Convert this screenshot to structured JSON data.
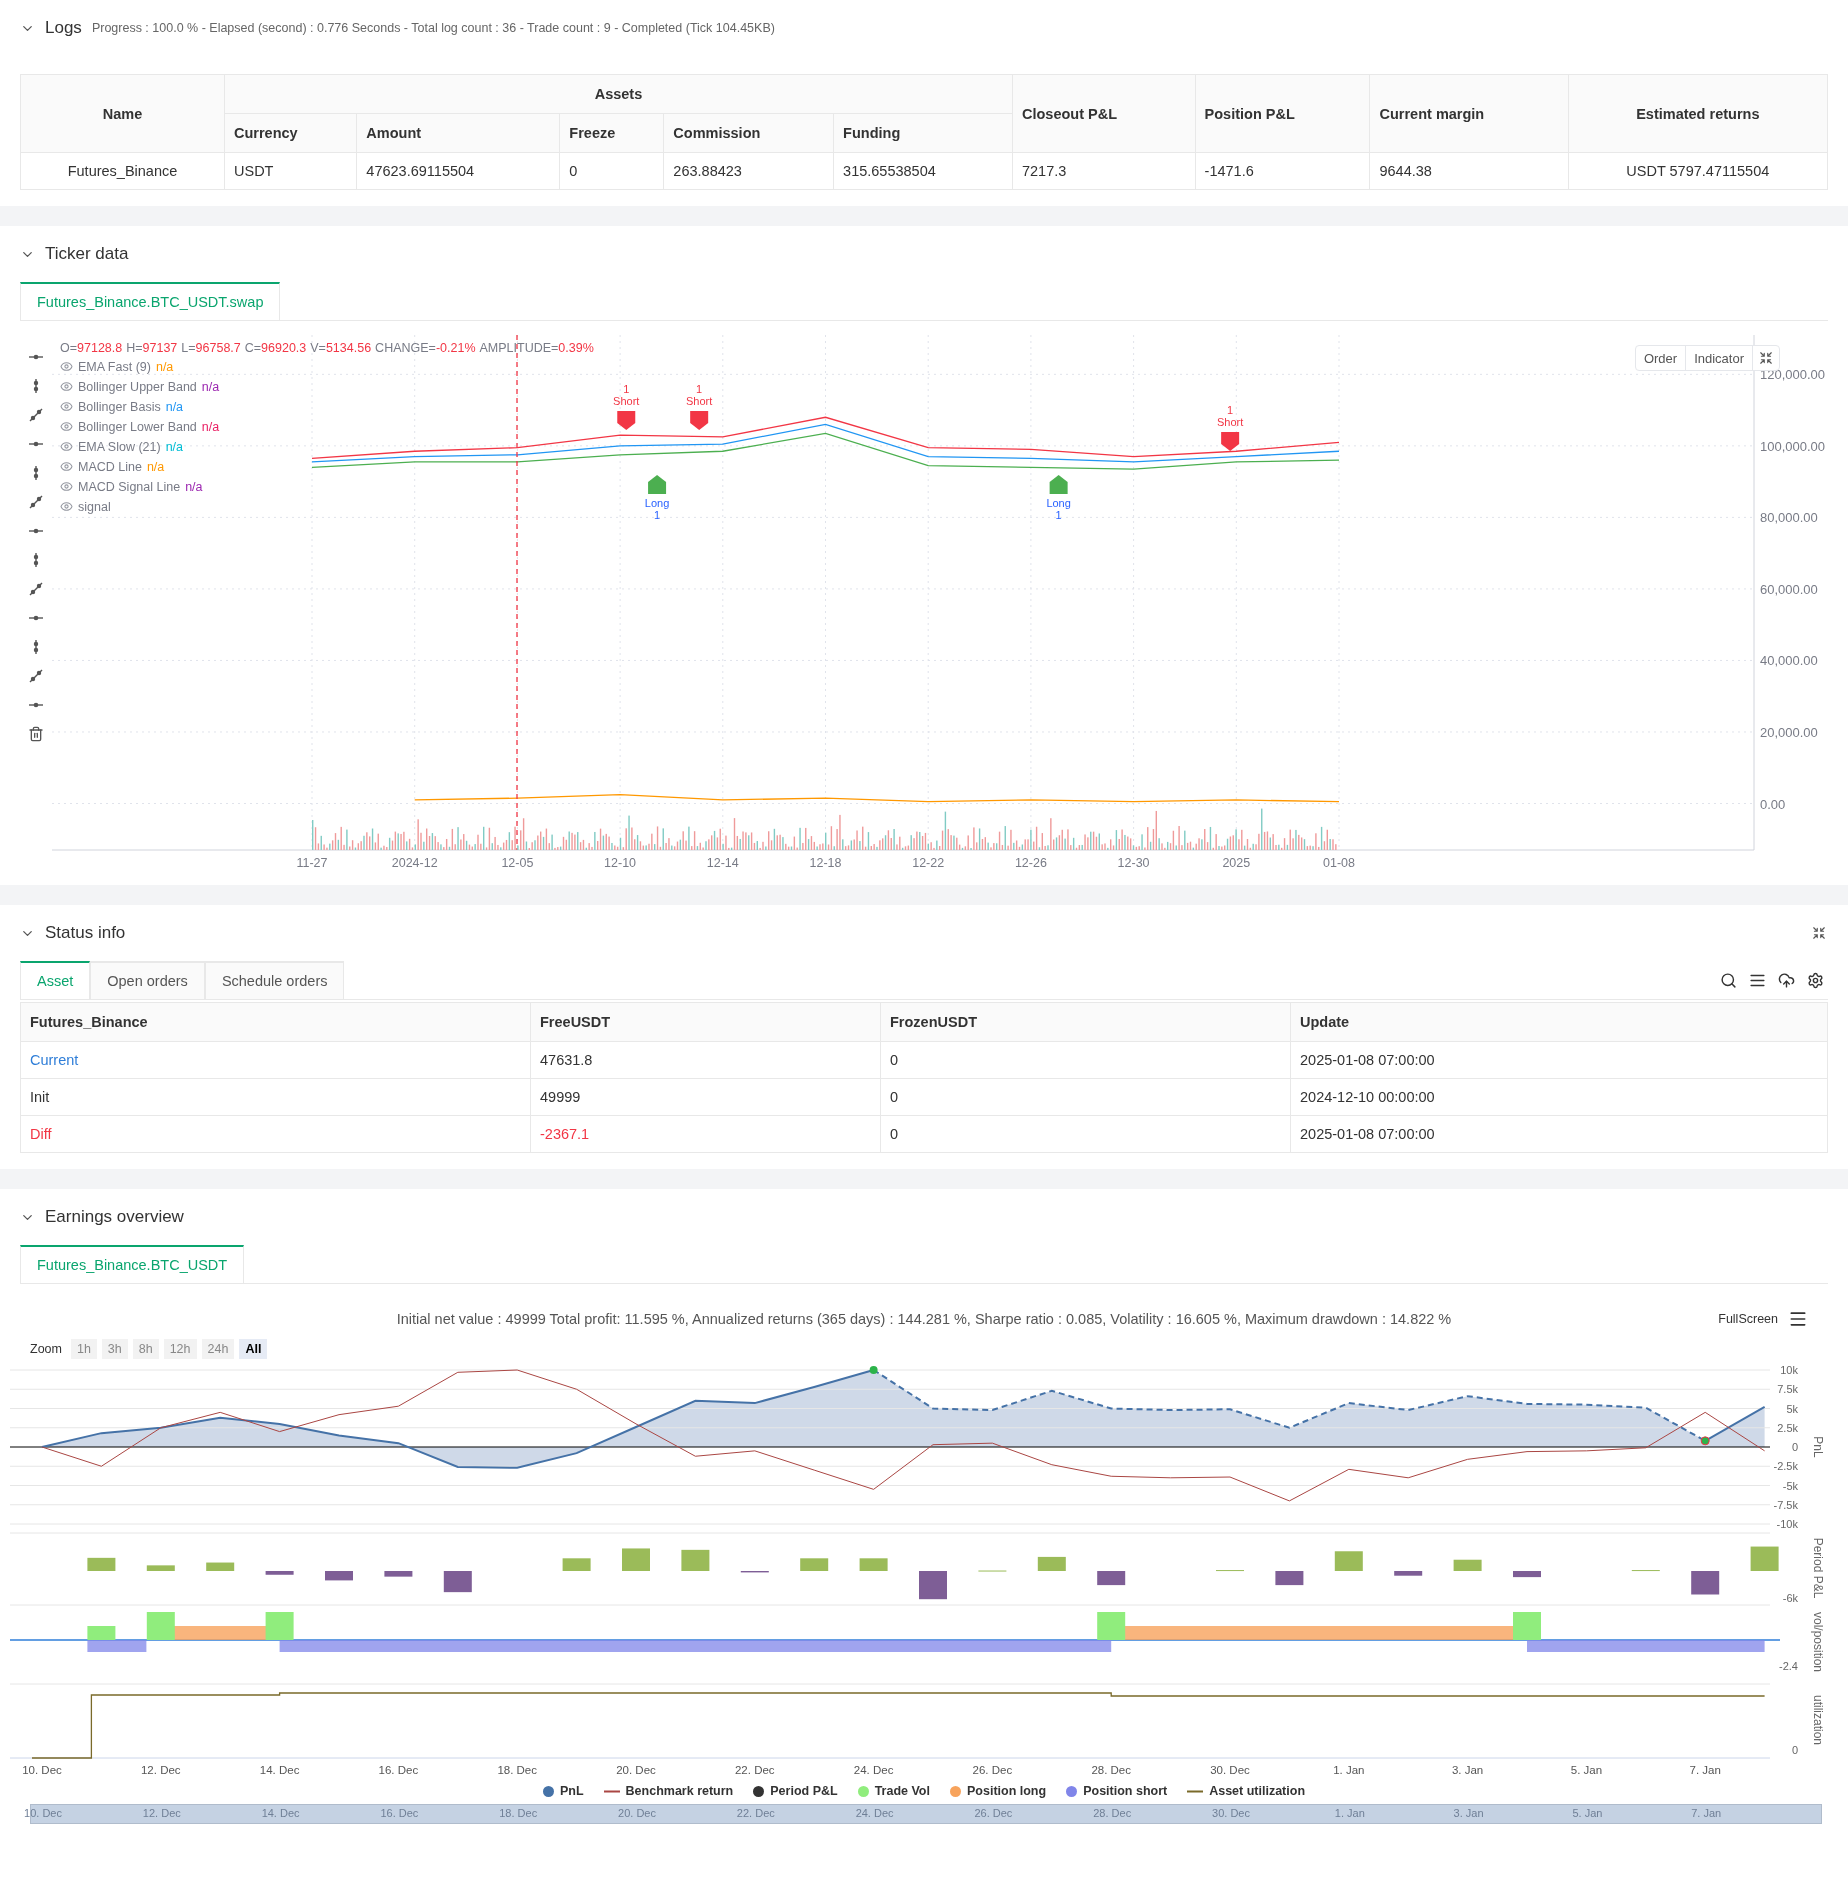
{
  "logs": {
    "title": "Logs",
    "summary": "Progress : 100.0 % - Elapsed (second) : 0.776  Seconds - Total log count : 36 - Trade count : 9 - Completed (Tick 104.45KB)",
    "table": {
      "name_header": "Name",
      "group_header": "Assets",
      "sub_headers": [
        "Currency",
        "Amount",
        "Freeze",
        "Commission",
        "Funding"
      ],
      "tail_headers": [
        "Closeout P&L",
        "Position P&L",
        "Current margin",
        "Estimated returns"
      ],
      "rows": [
        {
          "cells": [
            "Futures_Binance",
            "USDT",
            "47623.69115504",
            "0",
            "263.88423",
            "315.65538504",
            "7217.3",
            "-1471.6",
            "9644.38",
            "USDT 5797.47115504"
          ]
        }
      ]
    }
  },
  "ticker": {
    "title": "Ticker data",
    "tabs": [
      {
        "label": "Futures_Binance.BTC_USDT.swap",
        "selected": true
      }
    ],
    "ohlc": [
      {
        "label": "O=",
        "value": "97128.8"
      },
      {
        "label": "H=",
        "value": "97137"
      },
      {
        "label": "L=",
        "value": "96758.7"
      },
      {
        "label": "C=",
        "value": "96920.3"
      },
      {
        "label": "V=",
        "value": "5134.56"
      },
      {
        "label": "CHANGE=",
        "value": "-0.21%"
      },
      {
        "label": "AMPLITUDE=",
        "value": "0.39%"
      }
    ],
    "indicators": [
      {
        "name": "EMA Fast (9)",
        "value": "n/a",
        "color": "#ff9800"
      },
      {
        "name": "Bollinger Upper Band",
        "value": "n/a",
        "color": "#9c27b0"
      },
      {
        "name": "Bollinger Basis",
        "value": "n/a",
        "color": "#2196f3"
      },
      {
        "name": "Bollinger Lower Band",
        "value": "n/a",
        "color": "#e91e63"
      },
      {
        "name": "EMA Slow (21)",
        "value": "n/a",
        "color": "#00bcd4"
      },
      {
        "name": "MACD Line",
        "value": "n/a",
        "color": "#ff9800"
      },
      {
        "name": "MACD Signal Line",
        "value": "n/a",
        "color": "#9c27b0"
      },
      {
        "name": "signal"
      }
    ],
    "buttons": [
      "Order",
      "Indicator"
    ],
    "signals": [
      {
        "kind": "short",
        "count": "1",
        "label": "Short"
      },
      {
        "kind": "short",
        "count": "1",
        "label": "Short"
      },
      {
        "kind": "short",
        "count": "1",
        "label": "Short"
      },
      {
        "kind": "long",
        "count": "1",
        "label": "Long"
      },
      {
        "kind": "long",
        "count": "1",
        "label": "Long"
      }
    ],
    "chart_data": {
      "type": "line",
      "x": [
        "11-27",
        "2024-12",
        "12-05",
        "12-10",
        "12-14",
        "12-18",
        "12-22",
        "12-26",
        "12-30",
        "2025",
        "01-08"
      ],
      "series": [
        {
          "color": "#f23645",
          "values": [
            96500,
            98500,
            99500,
            103000,
            102500,
            108000,
            99500,
            99000,
            97000,
            98500,
            101000
          ]
        },
        {
          "color": "#2196f3",
          "values": [
            95500,
            97000,
            97500,
            100000,
            100500,
            106000,
            97000,
            96500,
            95500,
            97000,
            98500
          ]
        },
        {
          "color": "#4caf50",
          "values": [
            94000,
            95500,
            95500,
            97500,
            98500,
            103500,
            94500,
            94000,
            93500,
            95500,
            96000
          ]
        },
        {
          "color": "#ff9800",
          "values": [
            null,
            1000,
            1500,
            2500,
            1000,
            1500,
            500,
            1000,
            500,
            1000,
            500
          ]
        }
      ],
      "ylim": [
        -13000,
        131000
      ],
      "grid": true,
      "yticks": [
        {
          "value": 0,
          "label": "0.00"
        },
        {
          "value": 20000,
          "label": "20,000.00"
        },
        {
          "value": 40000,
          "label": "40,000.00"
        },
        {
          "value": 60000,
          "label": "60,000.00"
        },
        {
          "value": 80000,
          "label": "80,000.00"
        },
        {
          "value": 100000,
          "label": "100,000.00"
        },
        {
          "value": 120000,
          "label": "120,000.00"
        }
      ]
    }
  },
  "status": {
    "title": "Status info",
    "tabs": [
      {
        "label": "Asset",
        "selected": true
      },
      {
        "label": "Open orders",
        "selected": false
      },
      {
        "label": "Schedule orders",
        "selected": false
      }
    ],
    "columns": [
      "Futures_Binance",
      "FreeUSDT",
      "FrozenUSDT",
      "Update"
    ],
    "rows": [
      {
        "kind": "current",
        "cells": [
          "Current",
          "47631.8",
          "0",
          "2025-01-08 07:00:00"
        ]
      },
      {
        "kind": "plain",
        "cells": [
          "Init",
          "49999",
          "0",
          "2024-12-10 00:00:00"
        ]
      },
      {
        "kind": "diff",
        "cells": [
          "Diff",
          "-2367.1",
          "0",
          "2025-01-08 07:00:00"
        ]
      }
    ]
  },
  "earnings": {
    "title": "Earnings overview",
    "tabs": [
      {
        "label": "Futures_Binance.BTC_USDT",
        "selected": true
      }
    ],
    "summary": "Initial net value : 49999 Total profit: 11.595 %, Annualized returns (365 days) : 144.281 %, Sharpe ratio : 0.085, Volatility : 16.605 %, Maximum drawdown : 14.822 %",
    "fullscreen": "FullScreen",
    "zoom": {
      "label": "Zoom",
      "options": [
        {
          "label": "1h",
          "selected": false
        },
        {
          "label": "3h",
          "selected": false
        },
        {
          "label": "8h",
          "selected": false
        },
        {
          "label": "12h",
          "selected": false
        },
        {
          "label": "24h",
          "selected": false
        },
        {
          "label": "All",
          "selected": true
        }
      ]
    },
    "pnl_axis_title": "PnL",
    "x_labels": [
      "10. Dec",
      "12. Dec",
      "14. Dec",
      "16. Dec",
      "18. Dec",
      "20. Dec",
      "22. Dec",
      "24. Dec",
      "26. Dec",
      "28. Dec",
      "30. Dec",
      "1. Jan",
      "3. Jan",
      "5. Jan",
      "7. Jan"
    ],
    "chart_data": {
      "type": "line",
      "series": [
        {
          "color": "#4572a7",
          "values": [
            0,
            1800,
            2500,
            3800,
            3000,
            1500,
            500,
            -2600,
            -2700,
            -800,
            2600,
            6000,
            5700,
            7800,
            10000,
            5000,
            4800,
            7300,
            5000,
            4800,
            4900,
            2500,
            5700,
            4800,
            6600,
            5600,
            5500,
            5100,
            800,
            5200
          ]
        },
        {
          "color": "#aa4643",
          "values": [
            0,
            -2500,
            2500,
            4500,
            2000,
            4200,
            5300,
            9700,
            10000,
            7500,
            3000,
            -1200,
            -500,
            -3000,
            -5500,
            300,
            500,
            -2300,
            -3800,
            -4000,
            -3900,
            -7000,
            -2900,
            -4000,
            -1600,
            -600,
            -500,
            -100,
            4500,
            -500
          ]
        }
      ],
      "ylim": [
        -10000,
        10000
      ],
      "grid": true,
      "yticks": [
        {
          "value": -10000,
          "label": "-10k"
        },
        {
          "value": -7500,
          "label": "-7.5k"
        },
        {
          "value": -5000,
          "label": "-5k"
        },
        {
          "value": -2500,
          "label": "-2.5k"
        },
        {
          "value": 0,
          "label": "0"
        },
        {
          "value": 2500,
          "label": "2.5k"
        },
        {
          "value": 5000,
          "label": "5k"
        },
        {
          "value": 7500,
          "label": "7.5k"
        },
        {
          "value": 10000,
          "label": "10k"
        }
      ]
    },
    "period_panel": {
      "axis_title": "Period P&L",
      "tick": "-6k"
    },
    "position_panel": {
      "axis_title": "vol/position",
      "tick": "-2.4"
    },
    "utilization_panel": {
      "axis_title": "utilization",
      "tick": "0"
    },
    "legend": [
      {
        "label": "PnL",
        "color": "#4572a7",
        "kind": "dot"
      },
      {
        "label": "Benchmark return",
        "color": "#aa4643",
        "kind": "line"
      },
      {
        "label": "Period P&L",
        "color": "#333333",
        "kind": "dot"
      },
      {
        "label": "Trade Vol",
        "color": "#90ed7d",
        "kind": "dot"
      },
      {
        "label": "Position long",
        "color": "#f7a35c",
        "kind": "dot"
      },
      {
        "label": "Position short",
        "color": "#8085e9",
        "kind": "dot"
      },
      {
        "label": "Asset utilization",
        "color": "#7a6a2a",
        "kind": "line"
      }
    ],
    "navigator": {
      "labels": [
        "10. Dec",
        "12. Dec",
        "14. Dec",
        "16. Dec",
        "18. Dec",
        "20. Dec",
        "22. Dec",
        "24. Dec",
        "26. Dec",
        "28. Dec",
        "30. Dec",
        "1. Jan",
        "3. Jan",
        "5. Jan",
        "7. Jan"
      ]
    }
  }
}
